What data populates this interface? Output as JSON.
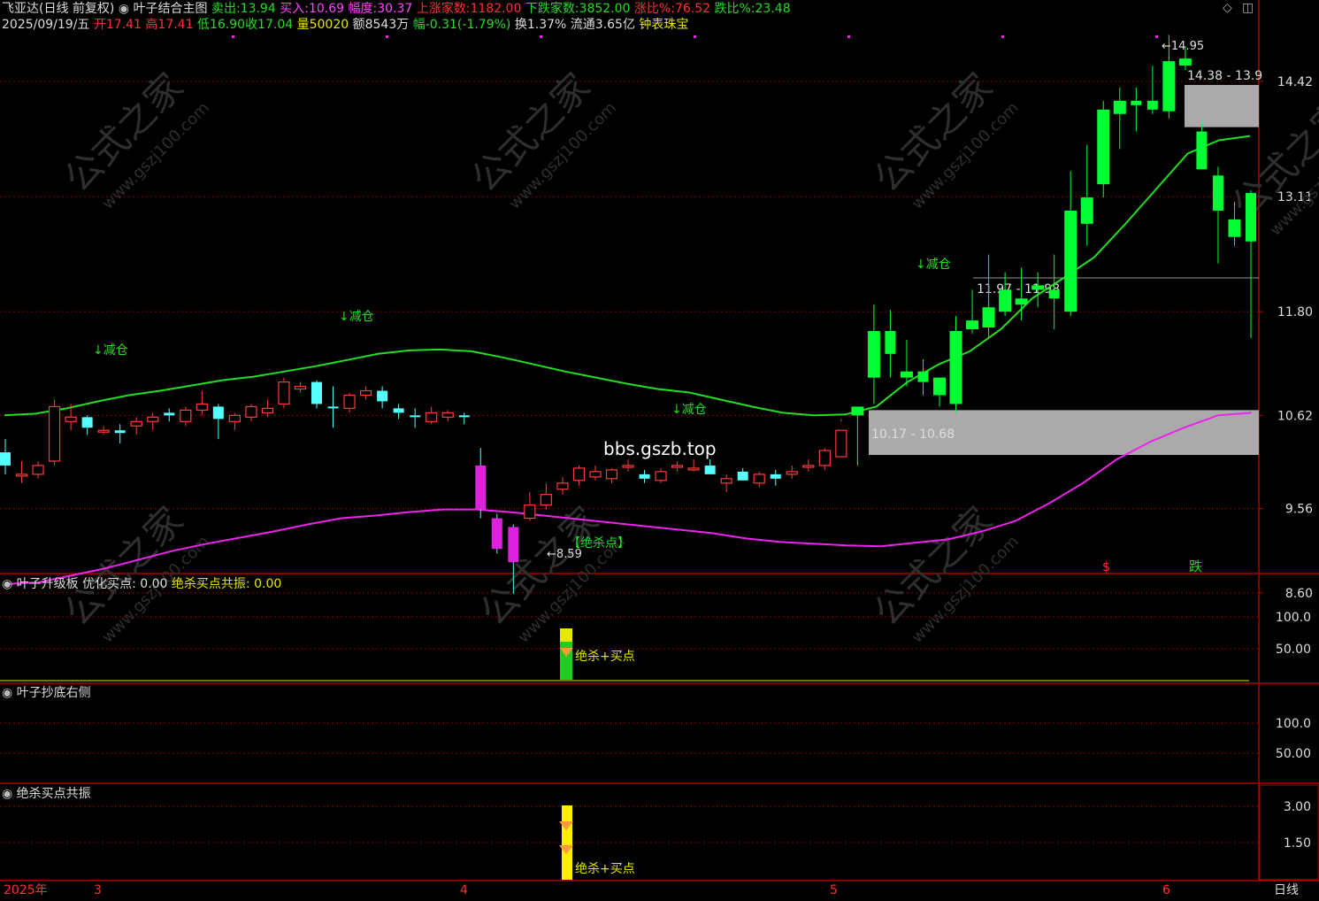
{
  "header": {
    "stock_name": "飞亚达(日线 前复权)",
    "indicator_name": "叶子结合主图",
    "sell_label": "卖出:",
    "sell_value": "13.94",
    "buy_label": "买入:",
    "buy_value": "10.69",
    "amplitude_label": "幅度:",
    "amplitude_value": "30.37",
    "up_count_label": "上涨家数:",
    "up_count_value": "1182.00",
    "down_count_label": "下跌家数:",
    "down_count_value": "3852.00",
    "up_ratio_label": "涨比%:",
    "up_ratio_value": "76.52",
    "down_ratio_label": "跌比%:",
    "down_ratio_value": "23.48",
    "date": "2025/09/19/五",
    "open": "开17.41",
    "high": "高17.41",
    "low": "低16.90",
    "close": "收17.04",
    "volume": "量50020",
    "amount": "额8543万",
    "change": "幅-0.31(-1.79%)",
    "turnover": "换1.37%",
    "float": "流通3.65亿",
    "sector": "钟表珠宝"
  },
  "icons": {
    "diamond": "diamond-icon",
    "window": "window-icon"
  },
  "colors": {
    "up": "#ff3b3b",
    "down_candle": "#54ffff",
    "green_line": "#22dd22",
    "magenta_line": "#ee22ee",
    "grid": "#8b0000",
    "zone": "#aaaaaa",
    "bright_green": "#00ff33"
  },
  "annotations": {
    "reduce": "↓减仓",
    "watermark_url": "bbs.gszb.top",
    "kill_point": "【绝杀点】",
    "low_price": "←8.59",
    "high_price": "←14.95",
    "zone_low": "10.17 - 10.68",
    "zone_high": "14.38 - 13.9",
    "zone_mid": "11.97 - 11.98",
    "dollar": "$",
    "fall": "跌",
    "kill_buy": "绝杀+买点"
  },
  "panels": {
    "p2_title": "叶子升级板",
    "p2_opt": "优化买点: 0.00",
    "p2_res": "绝杀买点共振: 0.00",
    "p3_title": "叶子抄底右侧",
    "p4_title": "绝杀买点共振"
  },
  "footer": {
    "year": "2025年",
    "m3": "3",
    "m4": "4",
    "m5": "5",
    "m6": "6",
    "period": "日线"
  },
  "chart_data": {
    "type": "candlestick",
    "price_axis": [
      "14.42",
      "13.11",
      "11.80",
      "10.62",
      "9.56",
      "8.60"
    ],
    "panel2_axis": [
      "100.0",
      "50.00"
    ],
    "panel3_axis": [
      "100.0",
      "50.00"
    ],
    "panel4_axis": [
      "3.00",
      "1.50"
    ],
    "candles": [
      [
        10.2,
        10.35,
        9.95,
        10.05
      ],
      [
        9.95,
        10.1,
        9.85,
        9.95
      ],
      [
        9.95,
        10.1,
        9.9,
        10.05
      ],
      [
        10.1,
        10.8,
        10.05,
        10.72
      ],
      [
        10.55,
        10.75,
        10.45,
        10.6
      ],
      [
        10.6,
        10.62,
        10.4,
        10.48
      ],
      [
        10.45,
        10.5,
        10.4,
        10.45
      ],
      [
        10.45,
        10.52,
        10.3,
        10.42
      ],
      [
        10.5,
        10.6,
        10.4,
        10.55
      ],
      [
        10.55,
        10.65,
        10.45,
        10.6
      ],
      [
        10.65,
        10.7,
        10.55,
        10.62
      ],
      [
        10.55,
        10.72,
        10.5,
        10.68
      ],
      [
        10.68,
        10.9,
        10.62,
        10.75
      ],
      [
        10.72,
        10.75,
        10.35,
        10.58
      ],
      [
        10.55,
        10.65,
        10.45,
        10.62
      ],
      [
        10.6,
        10.75,
        10.55,
        10.72
      ],
      [
        10.65,
        10.8,
        10.6,
        10.7
      ],
      [
        10.75,
        11.05,
        10.7,
        11.0
      ],
      [
        10.92,
        11.0,
        10.88,
        10.95
      ],
      [
        11.0,
        11.02,
        10.7,
        10.75
      ],
      [
        10.72,
        10.95,
        10.48,
        10.7
      ],
      [
        10.7,
        10.88,
        10.65,
        10.85
      ],
      [
        10.85,
        10.95,
        10.8,
        10.9
      ],
      [
        10.9,
        10.95,
        10.7,
        10.78
      ],
      [
        10.7,
        10.75,
        10.58,
        10.65
      ],
      [
        10.62,
        10.7,
        10.48,
        10.6
      ],
      [
        10.55,
        10.72,
        10.52,
        10.65
      ],
      [
        10.6,
        10.68,
        10.55,
        10.65
      ],
      [
        10.62,
        10.65,
        10.52,
        10.6
      ],
      [
        10.05,
        10.25,
        9.45,
        9.55
      ],
      [
        9.45,
        9.5,
        9.05,
        9.1
      ],
      [
        9.35,
        9.38,
        8.59,
        8.95
      ],
      [
        9.45,
        9.75,
        9.42,
        9.6
      ],
      [
        9.6,
        9.85,
        9.55,
        9.72
      ],
      [
        9.78,
        9.92,
        9.72,
        9.85
      ],
      [
        9.88,
        10.05,
        9.82,
        10.02
      ],
      [
        9.92,
        10.05,
        9.88,
        9.98
      ],
      [
        9.9,
        10.02,
        9.85,
        10.0
      ],
      [
        10.05,
        10.12,
        9.98,
        10.05
      ],
      [
        9.95,
        10.0,
        9.85,
        9.9
      ],
      [
        9.88,
        10.02,
        9.85,
        9.98
      ],
      [
        10.05,
        10.1,
        9.98,
        10.05
      ],
      [
        10.02,
        10.12,
        9.98,
        10.02
      ],
      [
        10.05,
        10.12,
        9.95,
        9.95
      ],
      [
        9.85,
        9.95,
        9.75,
        9.9
      ],
      [
        9.98,
        10.02,
        9.9,
        9.88
      ],
      [
        9.85,
        9.98,
        9.8,
        9.95
      ],
      [
        9.95,
        10.0,
        9.82,
        9.9
      ],
      [
        9.95,
        10.05,
        9.9,
        9.98
      ],
      [
        10.05,
        10.12,
        9.98,
        10.05
      ],
      [
        10.05,
        10.25,
        10.0,
        10.22
      ],
      [
        10.15,
        10.58,
        10.55,
        10.45
      ],
      [
        10.62,
        10.72,
        10.05,
        10.72
      ],
      [
        11.05,
        11.88,
        10.75,
        11.58
      ],
      [
        11.58,
        11.82,
        11.05,
        11.32
      ],
      [
        11.05,
        11.48,
        10.95,
        11.12
      ],
      [
        11.12,
        11.26,
        10.85,
        11.0
      ],
      [
        10.85,
        11.05,
        10.72,
        11.05
      ],
      [
        10.75,
        11.75,
        10.65,
        11.58
      ],
      [
        11.6,
        12.05,
        11.55,
        11.7
      ],
      [
        11.62,
        12.45,
        11.5,
        11.85
      ],
      [
        11.8,
        12.25,
        11.75,
        12.05
      ],
      [
        11.88,
        12.3,
        11.7,
        11.95
      ],
      [
        12.05,
        12.25,
        11.85,
        12.1
      ],
      [
        12.05,
        12.45,
        11.6,
        11.95
      ],
      [
        11.8,
        13.4,
        11.75,
        12.95
      ],
      [
        12.8,
        13.7,
        12.55,
        13.1
      ],
      [
        13.25,
        14.2,
        13.1,
        14.1
      ],
      [
        14.05,
        14.35,
        13.65,
        14.2
      ],
      [
        14.2,
        14.35,
        13.85,
        14.15
      ],
      [
        14.2,
        14.6,
        14.05,
        14.1
      ],
      [
        14.08,
        14.95,
        14.0,
        14.65
      ],
      [
        14.6,
        14.82,
        14.55,
        14.68
      ],
      [
        13.85,
        13.95,
        13.42,
        13.42
      ],
      [
        13.35,
        13.45,
        12.35,
        12.95
      ],
      [
        12.65,
        13.05,
        12.55,
        12.85
      ],
      [
        13.15,
        13.18,
        11.5,
        12.6
      ]
    ],
    "green_line": [
      10.62,
      10.64,
      10.7,
      10.78,
      10.85,
      10.9,
      10.96,
      11.02,
      11.06,
      11.12,
      11.18,
      11.25,
      11.32,
      11.36,
      11.37,
      11.35,
      11.28,
      11.2,
      11.12,
      11.05,
      10.98,
      10.92,
      10.88,
      10.8,
      10.72,
      10.65,
      10.62,
      10.63,
      10.72,
      11.0,
      11.2,
      11.35,
      11.6,
      11.95,
      12.18,
      12.42,
      12.8,
      13.2,
      13.6,
      13.75,
      13.8
    ],
    "magenta_line": [
      8.7,
      8.72,
      8.8,
      8.88,
      8.98,
      9.08,
      9.16,
      9.23,
      9.3,
      9.38,
      9.45,
      9.48,
      9.52,
      9.55,
      9.55,
      9.52,
      9.48,
      9.44,
      9.4,
      9.36,
      9.32,
      9.28,
      9.22,
      9.18,
      9.16,
      9.14,
      9.13,
      9.17,
      9.21,
      9.3,
      9.42,
      9.62,
      9.85,
      10.12,
      10.32,
      10.48,
      10.62,
      10.65
    ],
    "zones": [
      {
        "label": "10.17 - 10.68",
        "low": 10.17,
        "high": 10.68
      },
      {
        "label": "14.38 - 13.9",
        "low": 13.9,
        "high": 14.38
      },
      {
        "label": "11.97 - 11.98",
        "low": 11.97,
        "high": 11.98
      }
    ]
  }
}
